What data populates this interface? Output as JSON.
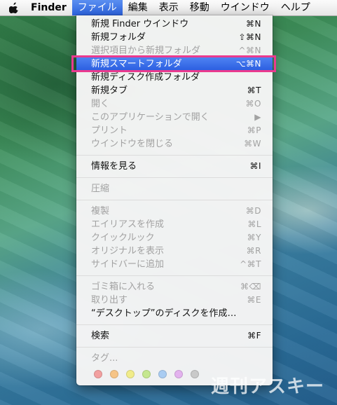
{
  "menubar": {
    "app_name": "Finder",
    "items": [
      "ファイル",
      "編集",
      "表示",
      "移動",
      "ウインドウ",
      "ヘルプ"
    ]
  },
  "menu": {
    "group1": [
      {
        "label": "新規 Finder ウインドウ",
        "shortcut": "⌘N",
        "enabled": true
      },
      {
        "label": "新規フォルダ",
        "shortcut": "⇧⌘N",
        "enabled": true
      },
      {
        "label": "選択項目から新規フォルダ",
        "shortcut": "^⌘N",
        "enabled": false
      },
      {
        "label": "新規スマートフォルダ",
        "shortcut": "⌥⌘N",
        "enabled": true,
        "highlighted": true
      },
      {
        "label": "新規ディスク作成フォルダ",
        "shortcut": "",
        "enabled": true
      },
      {
        "label": "新規タブ",
        "shortcut": "⌘T",
        "enabled": true
      },
      {
        "label": "開く",
        "shortcut": "⌘O",
        "enabled": false
      },
      {
        "label": "このアプリケーションで開く",
        "shortcut": "▶",
        "enabled": false
      },
      {
        "label": "プリント",
        "shortcut": "⌘P",
        "enabled": false
      },
      {
        "label": "ウインドウを閉じる",
        "shortcut": "⌘W",
        "enabled": false
      }
    ],
    "group2": [
      {
        "label": "情報を見る",
        "shortcut": "⌘I",
        "enabled": true
      }
    ],
    "group3": [
      {
        "label": "圧縮",
        "shortcut": "",
        "enabled": false
      }
    ],
    "group4": [
      {
        "label": "複製",
        "shortcut": "⌘D",
        "enabled": false
      },
      {
        "label": "エイリアスを作成",
        "shortcut": "⌘L",
        "enabled": false
      },
      {
        "label": "クイックルック",
        "shortcut": "⌘Y",
        "enabled": false
      },
      {
        "label": "オリジナルを表示",
        "shortcut": "⌘R",
        "enabled": false
      },
      {
        "label": "サイドバーに追加",
        "shortcut": "^⌘T",
        "enabled": false
      }
    ],
    "group5": [
      {
        "label": "ゴミ箱に入れる",
        "shortcut": "⌘⌫",
        "enabled": false
      },
      {
        "label": "取り出す",
        "shortcut": "⌘E",
        "enabled": false
      },
      {
        "label": "“デスクトップ”のディスクを作成…",
        "shortcut": "",
        "enabled": true
      }
    ],
    "group6": [
      {
        "label": "検索",
        "shortcut": "⌘F",
        "enabled": true
      }
    ],
    "tags_label": "タグ...",
    "tag_colors": [
      "#f2a0a0",
      "#f6c486",
      "#f1ec8a",
      "#c5e78f",
      "#a9ccf2",
      "#e3b2ee",
      "#c9c9c9"
    ]
  },
  "watermark": "週刊アスキー",
  "colors": {
    "highlight": "#2a5ee0",
    "annotation_frame": "#ea3a8f"
  }
}
